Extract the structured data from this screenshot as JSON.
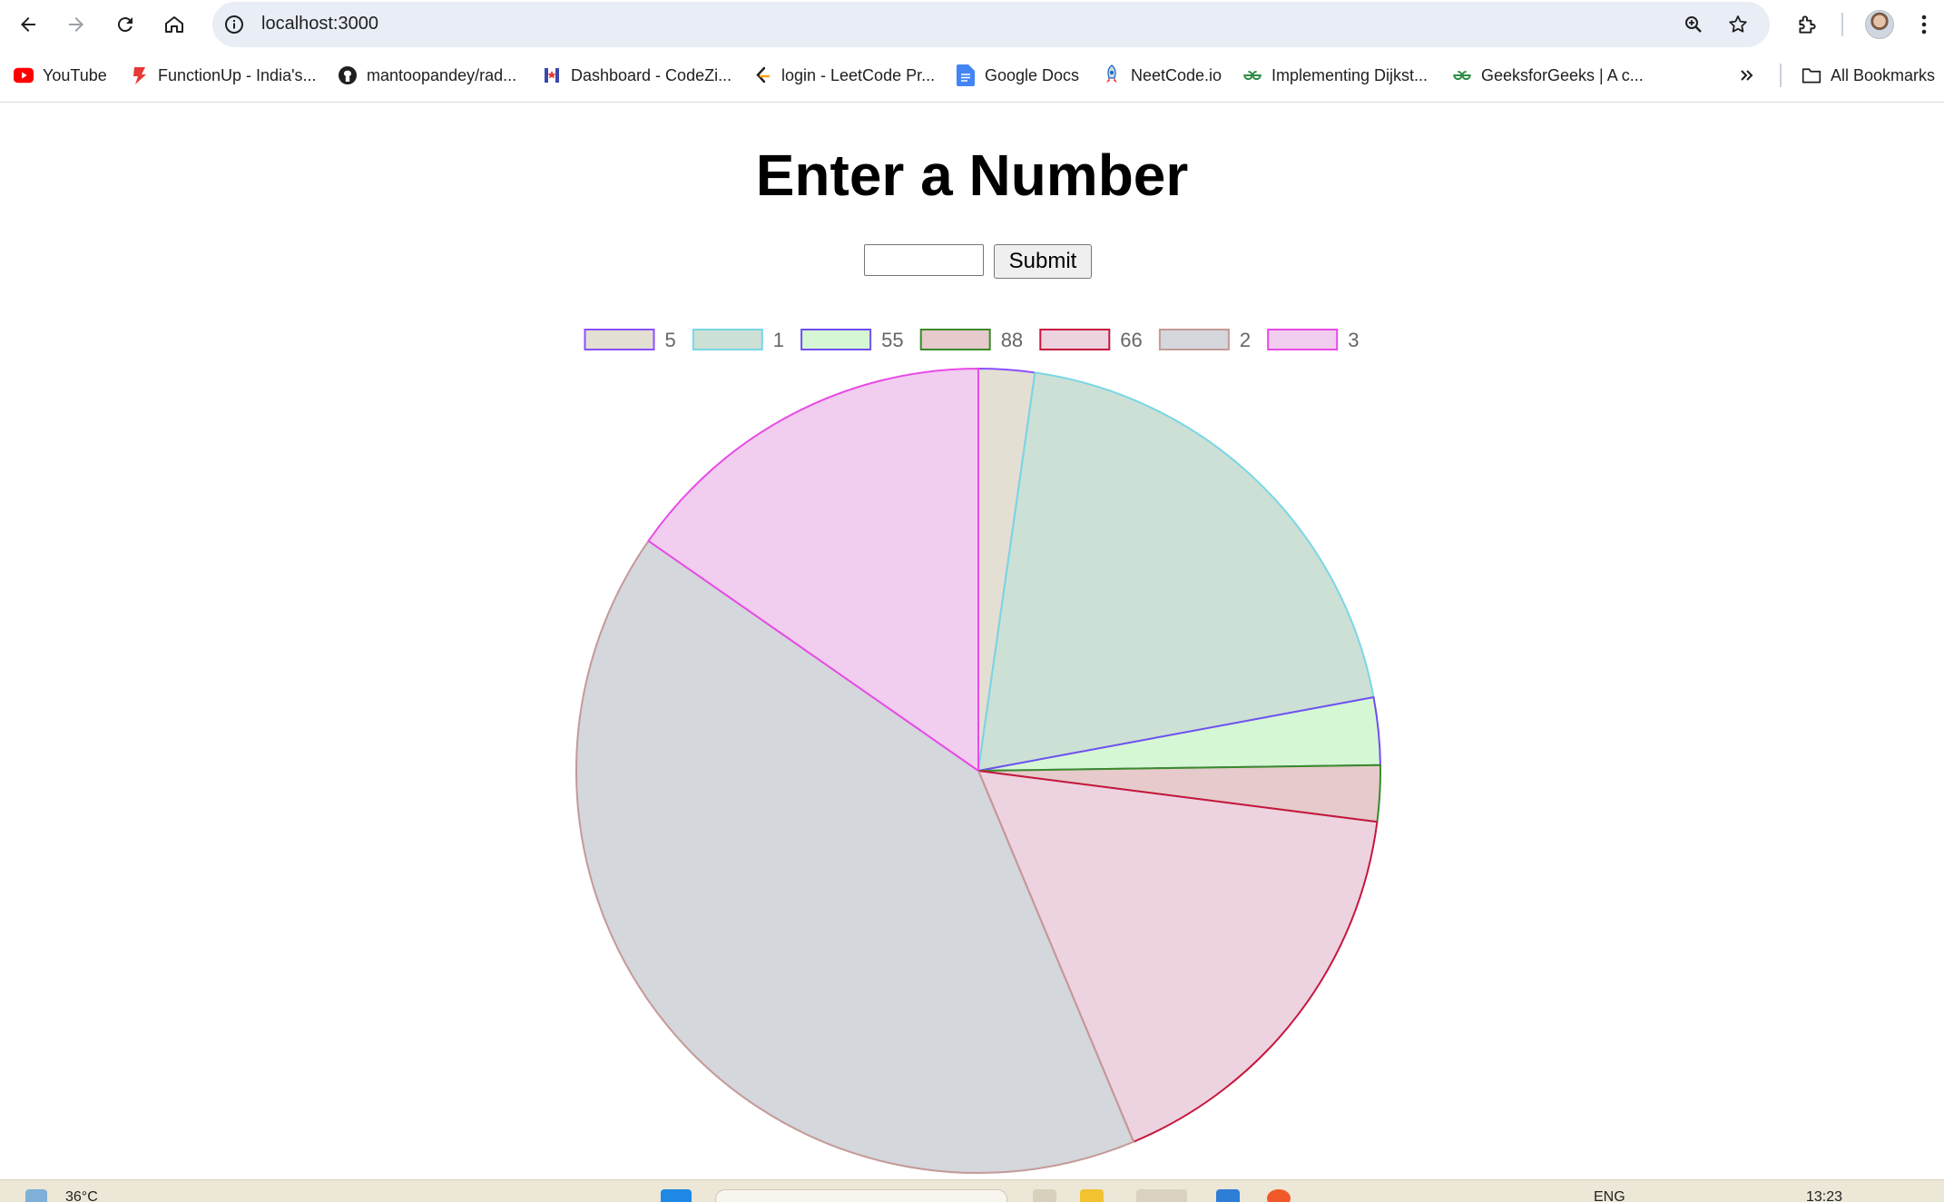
{
  "browser": {
    "url": "localhost:3000",
    "bookmarks": [
      {
        "label": "YouTube",
        "icon": "youtube-icon",
        "color": "#ff0000"
      },
      {
        "label": "FunctionUp - India's...",
        "icon": "functionup-icon",
        "color": "#e53935"
      },
      {
        "label": "mantoopandey/rad...",
        "icon": "github-icon",
        "color": "#1f1f1f"
      },
      {
        "label": "Dashboard - CodeZi...",
        "icon": "codezinger-icon",
        "color": "#3949ab"
      },
      {
        "label": "login - LeetCode Pr...",
        "icon": "leetcode-icon",
        "color": "#ffa116"
      },
      {
        "label": "Google Docs",
        "icon": "google-docs-icon",
        "color": "#4285f4"
      },
      {
        "label": "NeetCode.io",
        "icon": "neetcode-icon",
        "color": "#1565c0"
      },
      {
        "label": "Implementing Dijkst...",
        "icon": "geeksforgeeks-icon",
        "color": "#2f8d46"
      },
      {
        "label": "GeeksforGeeks | A c...",
        "icon": "geeksforgeeks-icon",
        "color": "#2f8d46"
      }
    ],
    "all_bookmarks_label": "All Bookmarks"
  },
  "page": {
    "title": "Enter a Number",
    "input_value": "",
    "submit_label": "Submit"
  },
  "chart_data": {
    "type": "pie",
    "categories": [
      "5",
      "1",
      "55",
      "88",
      "66",
      "2",
      "3"
    ],
    "values": [
      5,
      44,
      6,
      5,
      37,
      91,
      34
    ],
    "fill_colors": [
      "#e3e0d3",
      "#cce0d5",
      "#d5f7d4",
      "#e6cacc",
      "#ecd3df",
      "#d4d7dc",
      "#f1cdef"
    ],
    "border_colors": [
      "#8a4fff",
      "#79d7e5",
      "#6f4ff0",
      "#3a8a2a",
      "#c8163f",
      "#c49a98",
      "#e84be6"
    ],
    "legend_position": "top"
  },
  "taskbar": {
    "weather": "36°C",
    "language": "ENG",
    "time": "13:23"
  }
}
